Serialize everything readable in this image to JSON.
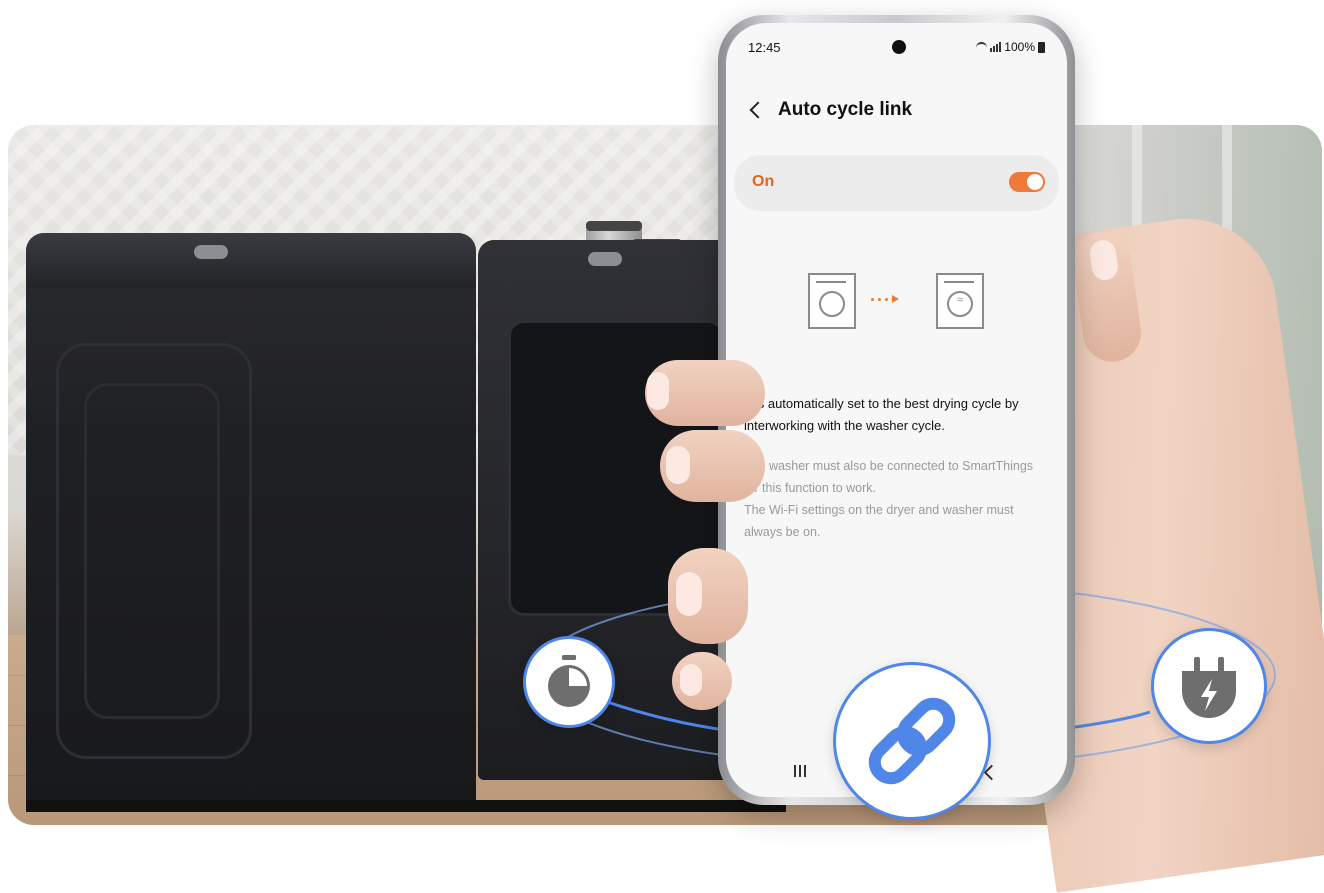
{
  "status_bar": {
    "time": "12:45",
    "battery": "100%"
  },
  "screen": {
    "title": "Auto cycle link",
    "toggle_label": "On",
    "toggle_state": "on",
    "description": "It is automatically set to the best drying cycle by interworking with the washer cycle.",
    "note_line1": "The washer must also be connected to SmartThings for this function to work.",
    "note_line2": "The Wi-Fi settings on the dryer and washer must always be on."
  },
  "feature_icons": {
    "left": "timer-icon",
    "center": "link-icon",
    "right": "power-plug-icon"
  },
  "colors": {
    "accent": "#f0793a",
    "link_blue": "#4f86e8",
    "icon_gray": "#6e6e6e"
  }
}
